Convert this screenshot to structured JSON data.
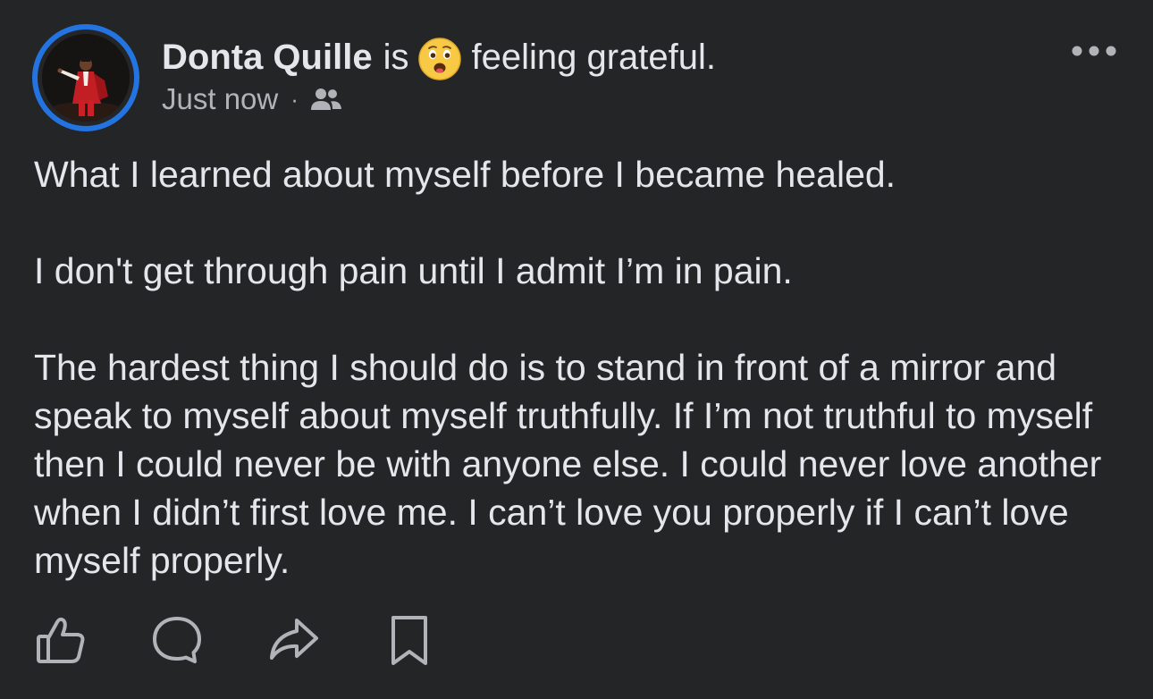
{
  "post": {
    "author": "Donta Quille",
    "is_word": "is",
    "feeling_emoji": "grateful-face-emoji",
    "feeling_text": "feeling grateful.",
    "timestamp": "Just now",
    "separator": "·",
    "audience_icon": "friends-icon",
    "more_icon": "more-options-icon",
    "body": [
      "What I learned about myself before I became healed.",
      "I don't get through pain until I admit I’m in pain.",
      "The hardest thing I should do is to stand in front of a mirror and speak to myself about myself truthfully. If I’m not truthful to myself then I could never be with anyone else. I could never love another when I didn’t first love me. I can’t love you properly if I can’t love myself properly."
    ]
  },
  "actions": {
    "icons": [
      "like-icon",
      "comment-icon",
      "share-icon",
      "save-icon"
    ]
  },
  "colors": {
    "background": "#242526",
    "text": "#e4e6eb",
    "secondary_text": "#b0b3b8",
    "avatar_ring": "#2374e1"
  }
}
